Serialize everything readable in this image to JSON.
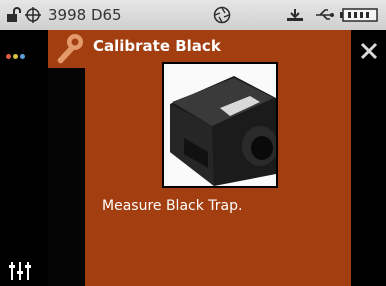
{
  "status_bar": {
    "device_label": "3998 D65",
    "icons": [
      "unlock-icon",
      "crosshair-icon",
      "aperture-icon",
      "antenna-icon",
      "usb-icon",
      "battery-icon"
    ]
  },
  "dialog": {
    "title": "Calibrate Black",
    "message": "Measure Black Trap.",
    "image": "black-trap-photo"
  },
  "colors": {
    "panel": "#a23e0f",
    "status_bar": "#dcdcdc",
    "rails": "#000000",
    "dot_1": "#e05a4a",
    "dot_2": "#d8c43c",
    "dot_3": "#5aa0d8"
  },
  "left_rail": {
    "icons": [
      "color-dots-icon",
      "sliders-icon"
    ]
  },
  "right_rail": {
    "icons": [
      "close-icon"
    ]
  }
}
